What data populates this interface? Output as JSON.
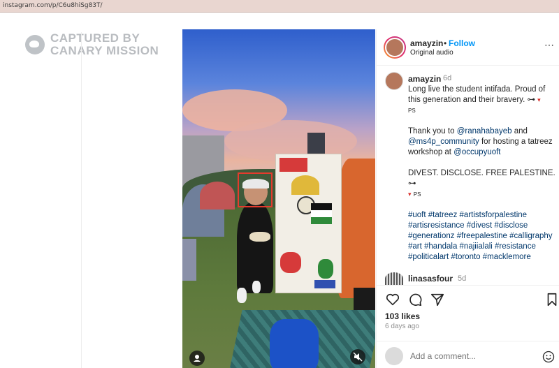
{
  "browser": {
    "url": "instagram.com/p/C6u8hiSg83T/"
  },
  "watermark": {
    "line1": "CAPTURED BY",
    "line2": "CANARY MISSION"
  },
  "post": {
    "username": "amayzin",
    "dot": "•",
    "follow_label": "Follow",
    "audio": "Original audio",
    "more_icon": "⋯",
    "caption": {
      "username": "amayzin",
      "time": "6d",
      "p1_text": "Long live the student intifada. Proud of this generation and their bravery. ",
      "p1_key": "⊶",
      "p1_heart": "▾",
      "p1_ps": "PS",
      "p2_a": "Thank you to ",
      "p2_tag1": "@ranahabayeb",
      "p2_b": " and ",
      "p2_tag2": "@ms4p_community",
      "p2_c": " for hosting a tatreez workshop at ",
      "p2_tag3": "@occupyuoft",
      "p3_text": "DIVEST. DISCLOSE. FREE PALESTINE. ",
      "p3_key": "⊶",
      "p3_heart": "▾",
      "p3_ps": "PS",
      "hashtags": "#uoft #tatreez #artistsforpalestine #artisresistance #divest #disclose #generationz #freepalestine #calligraphy #art #handala #najiialali #resistance #politicalart #toronto #macklemore"
    },
    "comment": {
      "username": "linasasfour",
      "time": "5d"
    },
    "likes": "103 likes",
    "ago": "6 days ago",
    "add_comment_placeholder": "Add a comment..."
  },
  "icons": {
    "heart": "heart-icon",
    "comment": "comment-icon",
    "share": "share-icon",
    "save": "bookmark-icon",
    "emoji": "emoji-icon",
    "person": "person-icon",
    "mute": "mute-icon",
    "logo": "canary-logo-icon"
  }
}
